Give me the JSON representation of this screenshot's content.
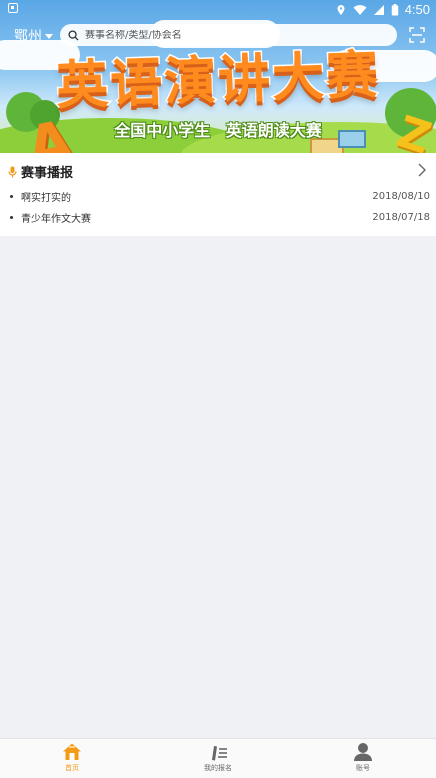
{
  "status_bar": {
    "time": "4:50",
    "icons": [
      "notification-icon",
      "location-icon",
      "wifi-icon",
      "signal-icon",
      "battery-icon"
    ]
  },
  "header": {
    "city": "鄂州",
    "search_placeholder": "赛事名称/类型/协会名",
    "icons": [
      "chevron-down-icon",
      "search-icon",
      "scan-icon"
    ]
  },
  "banner": {
    "title": "英语演讲大赛",
    "subtitle": "全国中小学生  英语朗读大赛"
  },
  "news": {
    "title": "赛事播报",
    "icon": "microphone-icon",
    "items": [
      {
        "text": "啊实打实的",
        "date": "2018/08/10"
      },
      {
        "text": "青少年作文大赛",
        "date": "2018/07/18"
      }
    ]
  },
  "tabbar": {
    "active_color": "#f39a17",
    "tabs": [
      {
        "label": "首页",
        "icon": "home-icon",
        "active": true
      },
      {
        "label": "我的报名",
        "icon": "edit-icon",
        "active": false
      },
      {
        "label": "账号",
        "icon": "user-icon",
        "active": false
      }
    ]
  }
}
